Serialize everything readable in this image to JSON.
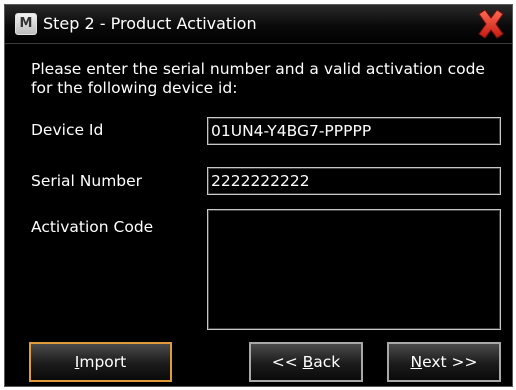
{
  "window": {
    "title": "Step 2 - Product Activation",
    "app_icon_letter": "M",
    "close_icon": "close-x-icon"
  },
  "form": {
    "prompt": "Please enter the serial number and a valid activation code for the following device id:",
    "device_id": {
      "label": "Device Id",
      "value": "01UN4-Y4BG7-PPPPP"
    },
    "serial_number": {
      "label": "Serial Number",
      "value": "2222222222"
    },
    "activation_code": {
      "label": "Activation Code",
      "value": ""
    }
  },
  "buttons": {
    "import": {
      "access_key": "I",
      "rest": "mport"
    },
    "back": {
      "pre": "<< ",
      "access_key": "B",
      "rest": "ack"
    },
    "next": {
      "access_key": "N",
      "rest": "ext >>"
    }
  },
  "colors": {
    "background": "#000000",
    "close_icon": "#e8392b",
    "default_button_border": "#e09a3a"
  }
}
